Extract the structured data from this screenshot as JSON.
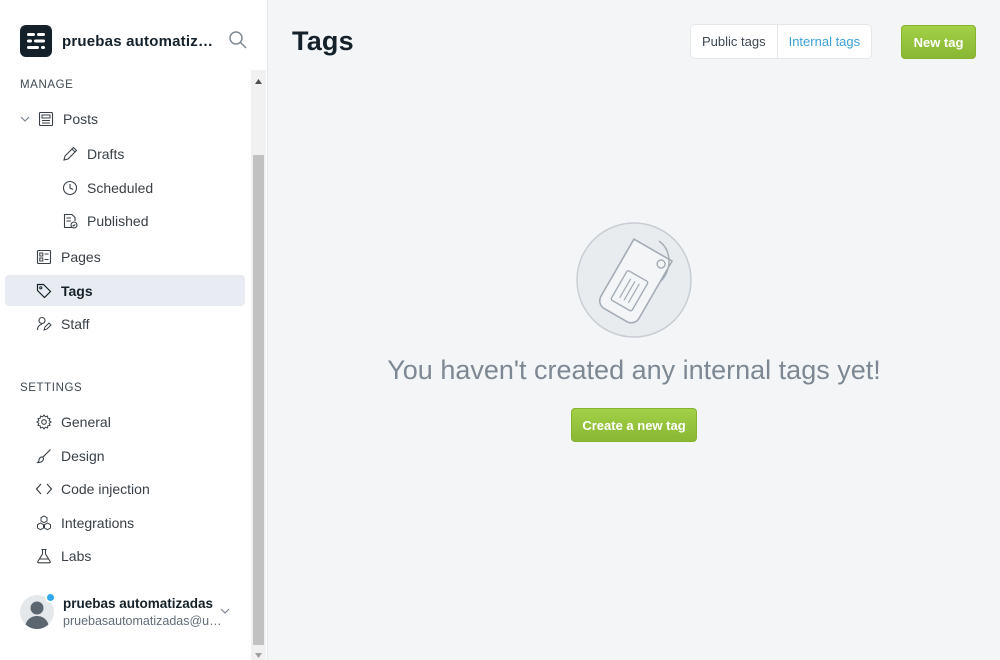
{
  "brand": {
    "name": "pruebas automatizadas",
    "logo_icon": "ghost-logo-icon"
  },
  "sidebar": {
    "manage_title": "MANAGE",
    "settings_title": "SETTINGS",
    "posts": {
      "label": "Posts"
    },
    "drafts": {
      "label": "Drafts"
    },
    "scheduled": {
      "label": "Scheduled"
    },
    "published": {
      "label": "Published"
    },
    "pages": {
      "label": "Pages"
    },
    "tags": {
      "label": "Tags"
    },
    "staff": {
      "label": "Staff"
    },
    "general": {
      "label": "General"
    },
    "design": {
      "label": "Design"
    },
    "code_injection": {
      "label": "Code injection"
    },
    "integrations": {
      "label": "Integrations"
    },
    "labs": {
      "label": "Labs"
    }
  },
  "user": {
    "name": "pruebas automatizadas",
    "email": "pruebasautomatizadas@uniandes.edu.co"
  },
  "header": {
    "title": "Tags",
    "tab_public": "Public tags",
    "tab_internal": "Internal tags",
    "new_tag": "New tag"
  },
  "empty": {
    "message": "You haven't created any internal tags yet!",
    "create_label": "Create a new tag"
  },
  "colors": {
    "accent": "#9fcd45",
    "link": "#3ba0d8",
    "online_dot": "#30a8ee"
  }
}
